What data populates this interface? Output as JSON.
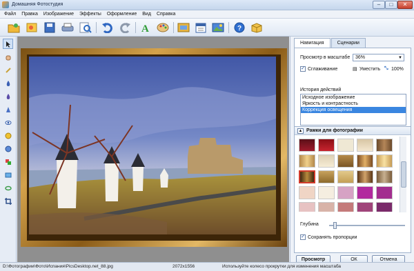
{
  "window": {
    "title": "Домашняя Фотостудия"
  },
  "menu": [
    "Файл",
    "Правка",
    "Изображение",
    "Эффекты",
    "Оформление",
    "Вид",
    "Справка"
  ],
  "toolbar": {
    "icons": [
      "open-icon",
      "gallery-icon",
      "save-icon",
      "print-icon",
      "zoom-icon",
      "undo-icon",
      "redo-icon",
      "text-icon",
      "palette-icon",
      "frame-icon",
      "calendar-icon",
      "collage-icon",
      "help-icon",
      "box-icon"
    ]
  },
  "right_panel": {
    "tabs": [
      "Навигация",
      "Сценарии"
    ],
    "zoom_label": "Просмотр в масштабе",
    "zoom_value": "36%",
    "smooth_label": "Сглаживание",
    "fit_label": "Уместить",
    "actual_label": "100%",
    "history_label": "История действий",
    "history_items": [
      "Исходное изображение",
      "Яркость и контрастность",
      "Коррекция освещения"
    ],
    "frames_title": "Рамки для фотографии",
    "depth_label": "Глубина",
    "keep_prop_label": "Сохранять пропорции",
    "preview_button": "Просмотр",
    "ok_button": "ОК",
    "cancel_button": "Отмена"
  },
  "status": {
    "path": "D:\\Фотографии\\Фото\\Испания\\PicsDesktop.net_88.jpg",
    "size": "2072x1556",
    "hint": "Используйте колесо прокрутки для изменения масштаба"
  },
  "colors": {
    "accent": "#3a86e0"
  }
}
